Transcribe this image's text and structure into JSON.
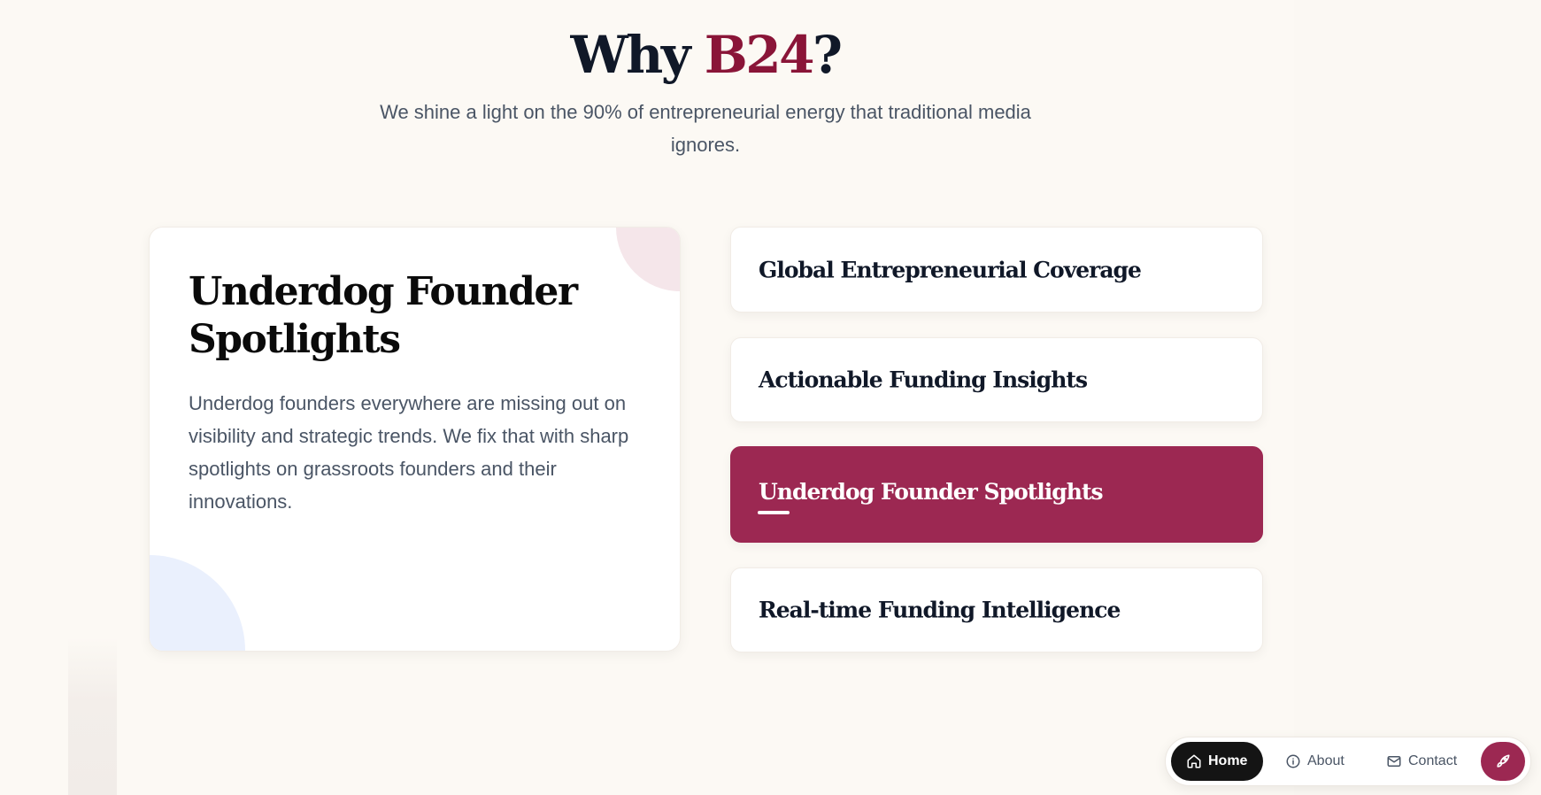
{
  "header": {
    "title_prefix": "Why ",
    "title_brand": "B24",
    "title_suffix": "?",
    "subtitle": "We shine a light on the 90% of entrepreneurial energy that traditional media ignores."
  },
  "detail": {
    "title": "Underdog Founder Spotlights",
    "text": "Underdog founders everywhere are missing out on visibility and strategic trends. We fix that with sharp spotlights on grassroots founders and their innovations."
  },
  "features": [
    {
      "label": "Global Entrepreneurial Coverage",
      "active": false
    },
    {
      "label": "Actionable Funding Insights",
      "active": false
    },
    {
      "label": "Underdog Founder Spotlights",
      "active": true
    },
    {
      "label": "Real-time Funding Intelligence",
      "active": false
    }
  ],
  "nav": {
    "home": "Home",
    "about": "About",
    "contact": "Contact"
  },
  "colors": {
    "accent": "#9c2852",
    "brand_text": "#8a1538",
    "background": "#fcf9f4"
  },
  "icons": {
    "home": "home-icon",
    "about": "info-icon",
    "contact": "mail-icon",
    "action": "rocket-icon"
  }
}
